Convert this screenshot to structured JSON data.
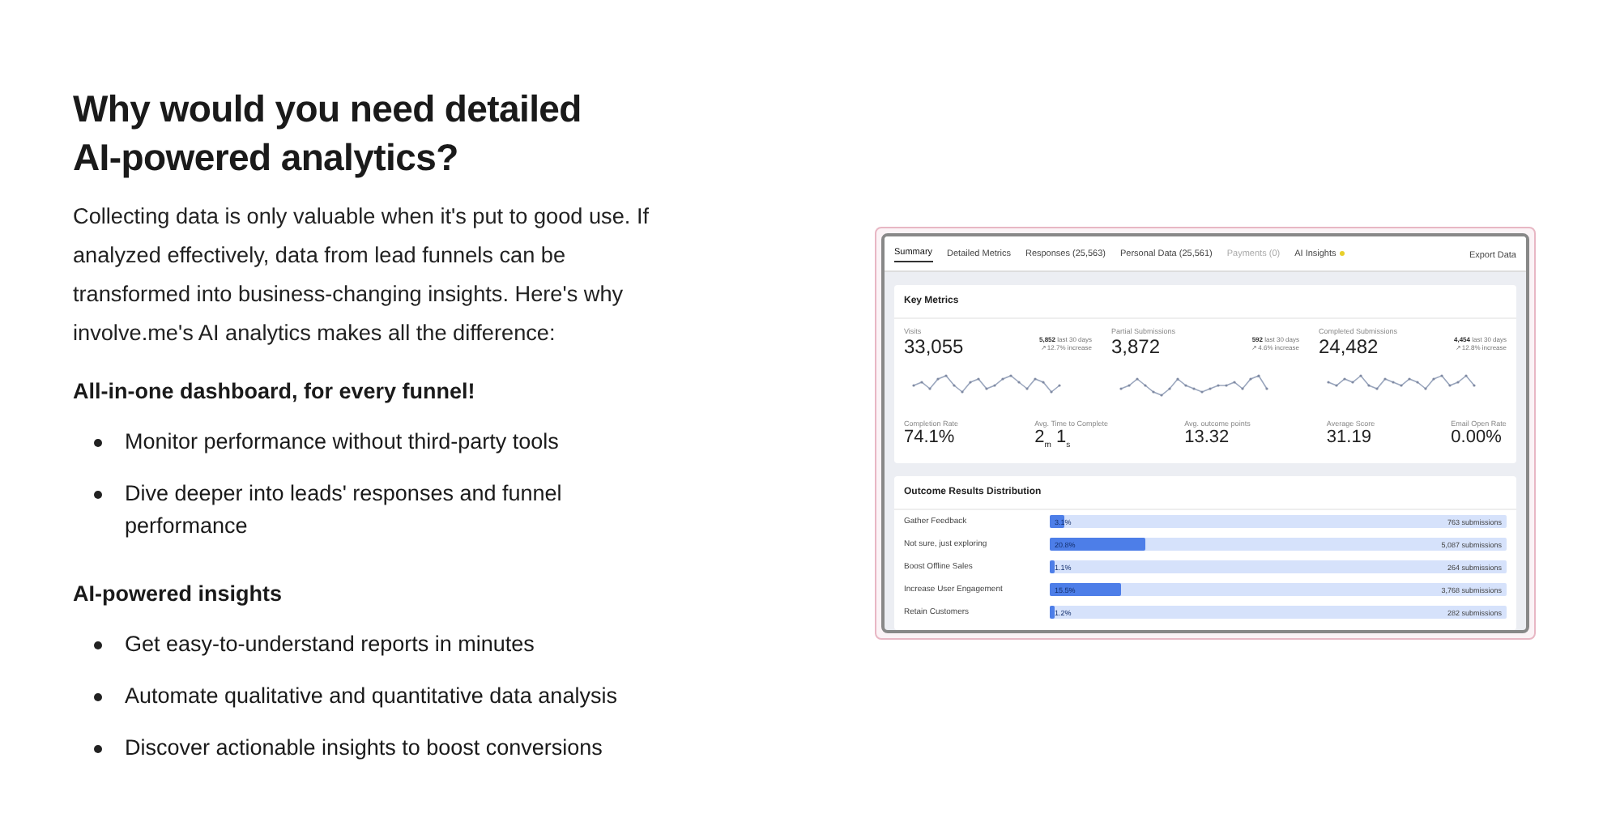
{
  "heading": "Why would you need detailed AI-powered analytics?",
  "intro": "Collecting data is only valuable when it's put to good use. If analyzed effectively, data from lead funnels can be transformed into business-changing insights. Here's why involve.me's AI analytics makes all the difference:",
  "sections": [
    {
      "title": "All-in-one dashboard, for every funnel!",
      "bullets": [
        "Monitor performance without third-party tools",
        "Dive deeper into leads' responses and funnel performance"
      ]
    },
    {
      "title": "AI-powered insights",
      "bullets": [
        "Get easy-to-understand reports in minutes",
        "Automate qualitative and quantitative data analysis",
        "Discover actionable insights to boost conversions"
      ]
    }
  ],
  "dashboard": {
    "tabs": [
      {
        "label": "Summary",
        "selected": true,
        "disabled": false
      },
      {
        "label": "Detailed Metrics",
        "selected": false,
        "disabled": false
      },
      {
        "label": "Responses (25,563)",
        "selected": false,
        "disabled": false
      },
      {
        "label": "Personal Data (25,561)",
        "selected": false,
        "disabled": false
      },
      {
        "label": "Payments (0)",
        "selected": false,
        "disabled": true
      },
      {
        "label": "AI Insights",
        "selected": false,
        "disabled": false
      }
    ],
    "export": "Export Data",
    "key_metrics": {
      "title": "Key Metrics",
      "main": [
        {
          "label": "Visits",
          "value": "33,055",
          "delta": "5,852",
          "period": "last 30 days",
          "change": "↗ 12.7% increase"
        },
        {
          "label": "Partial Submissions",
          "value": "3,872",
          "delta": "592",
          "period": "last 30 days",
          "change": "↗ 4.6% increase"
        },
        {
          "label": "Completed Submissions",
          "value": "24,482",
          "delta": "4,454",
          "period": "last 30 days",
          "change": "↗ 12.8% increase"
        }
      ],
      "secondary": [
        {
          "label": "Completion Rate",
          "value": "74.1%"
        },
        {
          "label": "Avg. Time to Complete",
          "value": "2$_{m}$ 1$_{s}$"
        },
        {
          "label": "Avg. outcome points",
          "value": "13.32"
        },
        {
          "label": "Average Score",
          "value": "31.19"
        },
        {
          "label": "Email Open Rate",
          "value": "0.00%"
        }
      ]
    },
    "outcomes": {
      "title": "Outcome Results Distribution",
      "rows": [
        {
          "label": "Gather Feedback",
          "percent": "3.1%",
          "level": 0.031,
          "count": "763 submissions"
        },
        {
          "label": "Not sure, just exploring",
          "percent": "20.8%",
          "level": 0.208,
          "count": "5,087 submissions"
        },
        {
          "label": "Boost Offline Sales",
          "percent": "1.1%",
          "level": 0.011,
          "count": "264 submissions"
        },
        {
          "label": "Increase User Engagement",
          "percent": "15.5%",
          "level": 0.155,
          "count": "3,768 submissions"
        },
        {
          "label": "Retain Customers",
          "percent": "1.2%",
          "level": 0.012,
          "count": "282 submissions"
        }
      ]
    }
  }
}
